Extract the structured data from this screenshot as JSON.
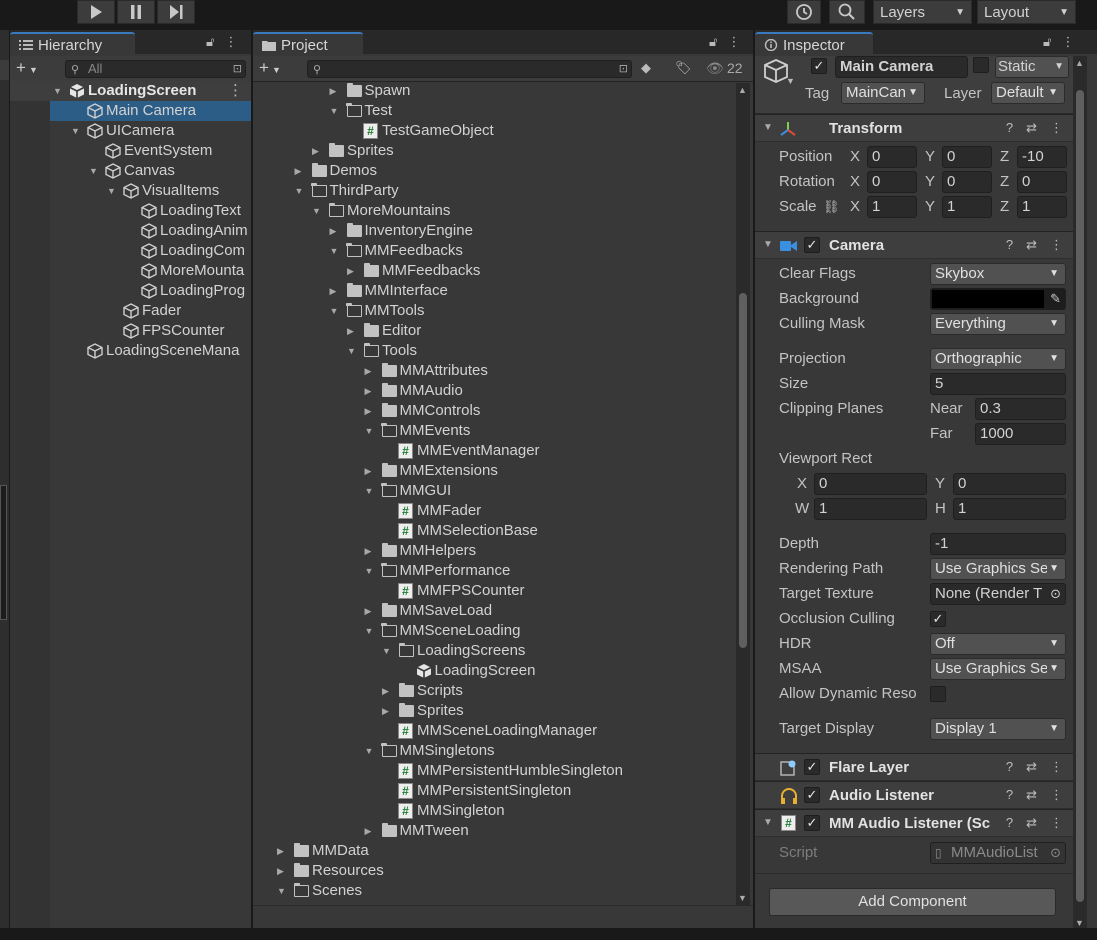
{
  "toolbar": {
    "play_icon": "play-icon",
    "pause_icon": "pause-icon",
    "step_icon": "step-icon",
    "history_icon": "history-icon",
    "search_icon": "search-icon",
    "layers_label": "Layers",
    "layout_label": "Layout"
  },
  "hierarchy": {
    "tab_label": "Hierarchy",
    "search_placeholder": "All",
    "rows": [
      {
        "label": "LoadingScreen",
        "indent": 0,
        "arrow": "down",
        "icon": "unity",
        "header": true
      },
      {
        "label": "Main Camera",
        "indent": 1,
        "arrow": "",
        "icon": "cube",
        "selected": true
      },
      {
        "label": "UICamera",
        "indent": 1,
        "arrow": "down",
        "icon": "cube"
      },
      {
        "label": "EventSystem",
        "indent": 2,
        "arrow": "",
        "icon": "cube"
      },
      {
        "label": "Canvas",
        "indent": 2,
        "arrow": "down",
        "icon": "cube"
      },
      {
        "label": "VisualItems",
        "indent": 3,
        "arrow": "down",
        "icon": "cube"
      },
      {
        "label": "LoadingText",
        "indent": 4,
        "arrow": "",
        "icon": "cube"
      },
      {
        "label": "LoadingAnim",
        "indent": 4,
        "arrow": "",
        "icon": "cube"
      },
      {
        "label": "LoadingCom",
        "indent": 4,
        "arrow": "",
        "icon": "cube"
      },
      {
        "label": "MoreMounta",
        "indent": 4,
        "arrow": "",
        "icon": "cube"
      },
      {
        "label": "LoadingProg",
        "indent": 4,
        "arrow": "",
        "icon": "cube"
      },
      {
        "label": "Fader",
        "indent": 3,
        "arrow": "",
        "icon": "cube"
      },
      {
        "label": "FPSCounter",
        "indent": 3,
        "arrow": "",
        "icon": "cube"
      },
      {
        "label": "LoadingSceneMana",
        "indent": 1,
        "arrow": "",
        "icon": "cube"
      }
    ]
  },
  "project": {
    "tab_label": "Project",
    "eye_count": "22",
    "rows": [
      {
        "label": "Spawn",
        "indent": 3,
        "arrow": "right",
        "icon": "folder"
      },
      {
        "label": "Test",
        "indent": 3,
        "arrow": "down",
        "icon": "folder-open"
      },
      {
        "label": "TestGameObject",
        "indent": 4,
        "arrow": "",
        "icon": "script"
      },
      {
        "label": "Sprites",
        "indent": 2,
        "arrow": "right",
        "icon": "folder"
      },
      {
        "label": "Demos",
        "indent": 1,
        "arrow": "right",
        "icon": "folder"
      },
      {
        "label": "ThirdParty",
        "indent": 1,
        "arrow": "down",
        "icon": "folder-open"
      },
      {
        "label": "MoreMountains",
        "indent": 2,
        "arrow": "down",
        "icon": "folder-open"
      },
      {
        "label": "InventoryEngine",
        "indent": 3,
        "arrow": "right",
        "icon": "folder"
      },
      {
        "label": "MMFeedbacks",
        "indent": 3,
        "arrow": "down",
        "icon": "folder-open"
      },
      {
        "label": "MMFeedbacks",
        "indent": 4,
        "arrow": "right",
        "icon": "folder"
      },
      {
        "label": "MMInterface",
        "indent": 3,
        "arrow": "right",
        "icon": "folder"
      },
      {
        "label": "MMTools",
        "indent": 3,
        "arrow": "down",
        "icon": "folder-open"
      },
      {
        "label": "Editor",
        "indent": 4,
        "arrow": "right",
        "icon": "folder"
      },
      {
        "label": "Tools",
        "indent": 4,
        "arrow": "down",
        "icon": "folder-open"
      },
      {
        "label": "MMAttributes",
        "indent": 5,
        "arrow": "right",
        "icon": "folder"
      },
      {
        "label": "MMAudio",
        "indent": 5,
        "arrow": "right",
        "icon": "folder"
      },
      {
        "label": "MMControls",
        "indent": 5,
        "arrow": "right",
        "icon": "folder"
      },
      {
        "label": "MMEvents",
        "indent": 5,
        "arrow": "down",
        "icon": "folder-open"
      },
      {
        "label": "MMEventManager",
        "indent": 6,
        "arrow": "",
        "icon": "script"
      },
      {
        "label": "MMExtensions",
        "indent": 5,
        "arrow": "right",
        "icon": "folder"
      },
      {
        "label": "MMGUI",
        "indent": 5,
        "arrow": "down",
        "icon": "folder-open"
      },
      {
        "label": "MMFader",
        "indent": 6,
        "arrow": "",
        "icon": "script"
      },
      {
        "label": "MMSelectionBase",
        "indent": 6,
        "arrow": "",
        "icon": "script"
      },
      {
        "label": "MMHelpers",
        "indent": 5,
        "arrow": "right",
        "icon": "folder"
      },
      {
        "label": "MMPerformance",
        "indent": 5,
        "arrow": "down",
        "icon": "folder-open"
      },
      {
        "label": "MMFPSCounter",
        "indent": 6,
        "arrow": "",
        "icon": "script"
      },
      {
        "label": "MMSaveLoad",
        "indent": 5,
        "arrow": "right",
        "icon": "folder"
      },
      {
        "label": "MMSceneLoading",
        "indent": 5,
        "arrow": "down",
        "icon": "folder-open"
      },
      {
        "label": "LoadingScreens",
        "indent": 6,
        "arrow": "down",
        "icon": "folder-open"
      },
      {
        "label": "LoadingScreen",
        "indent": 7,
        "arrow": "",
        "icon": "unity"
      },
      {
        "label": "Scripts",
        "indent": 6,
        "arrow": "right",
        "icon": "folder"
      },
      {
        "label": "Sprites",
        "indent": 6,
        "arrow": "right",
        "icon": "folder"
      },
      {
        "label": "MMSceneLoadingManager",
        "indent": 6,
        "arrow": "",
        "icon": "script"
      },
      {
        "label": "MMSingletons",
        "indent": 5,
        "arrow": "down",
        "icon": "folder-open"
      },
      {
        "label": "MMPersistentHumbleSingleton",
        "indent": 6,
        "arrow": "",
        "icon": "script"
      },
      {
        "label": "MMPersistentSingleton",
        "indent": 6,
        "arrow": "",
        "icon": "script"
      },
      {
        "label": "MMSingleton",
        "indent": 6,
        "arrow": "",
        "icon": "script"
      },
      {
        "label": "MMTween",
        "indent": 5,
        "arrow": "right",
        "icon": "folder"
      },
      {
        "label": "MMData",
        "indent": 0,
        "arrow": "right",
        "icon": "folder"
      },
      {
        "label": "Resources",
        "indent": 0,
        "arrow": "right",
        "icon": "folder"
      },
      {
        "label": "Scenes",
        "indent": 0,
        "arrow": "down",
        "icon": "folder-open"
      }
    ]
  },
  "inspector": {
    "tab_label": "Inspector",
    "object_name": "Main Camera",
    "static_label": "Static",
    "tag_label": "Tag",
    "tag_value": "MainCan",
    "layer_label": "Layer",
    "layer_value": "Default",
    "transform": {
      "title": "Transform",
      "position_label": "Position",
      "rotation_label": "Rotation",
      "scale_label": "Scale",
      "axis_x": "X",
      "axis_y": "Y",
      "axis_z": "Z",
      "position": [
        "0",
        "0",
        "-10"
      ],
      "rotation": [
        "0",
        "0",
        "0"
      ],
      "scale": [
        "1",
        "1",
        "1"
      ]
    },
    "camera": {
      "title": "Camera",
      "clear_flags_label": "Clear Flags",
      "clear_flags_value": "Skybox",
      "background_label": "Background",
      "background_color": "#000000",
      "culling_mask_label": "Culling Mask",
      "culling_mask_value": "Everything",
      "projection_label": "Projection",
      "projection_value": "Orthographic",
      "size_label": "Size",
      "size_value": "5",
      "clipping_label": "Clipping Planes",
      "near_label": "Near",
      "near_value": "0.3",
      "far_label": "Far",
      "far_value": "1000",
      "viewport_label": "Viewport Rect",
      "vp_x_label": "X",
      "vp_x": "0",
      "vp_y_label": "Y",
      "vp_y": "0",
      "vp_w_label": "W",
      "vp_w": "1",
      "vp_h_label": "H",
      "vp_h": "1",
      "depth_label": "Depth",
      "depth_value": "-1",
      "rendering_path_label": "Rendering Path",
      "rendering_path_value": "Use Graphics Se",
      "target_texture_label": "Target Texture",
      "target_texture_value": "None (Render T",
      "occlusion_label": "Occlusion Culling",
      "hdr_label": "HDR",
      "hdr_value": "Off",
      "msaa_label": "MSAA",
      "msaa_value": "Use Graphics Se",
      "dynamic_res_label": "Allow Dynamic Reso",
      "target_display_label": "Target Display",
      "target_display_value": "Display 1"
    },
    "flare_layer_title": "Flare Layer",
    "audio_listener_title": "Audio Listener",
    "mm_audio_listener_title": "MM Audio Listener (Sc",
    "script_label": "Script",
    "script_value": "MMAudioList",
    "add_component_label": "Add Component"
  },
  "colors": {
    "selection": "#2c5d87",
    "tab_accent": "#3a79bb",
    "panel_bg": "#383838"
  }
}
